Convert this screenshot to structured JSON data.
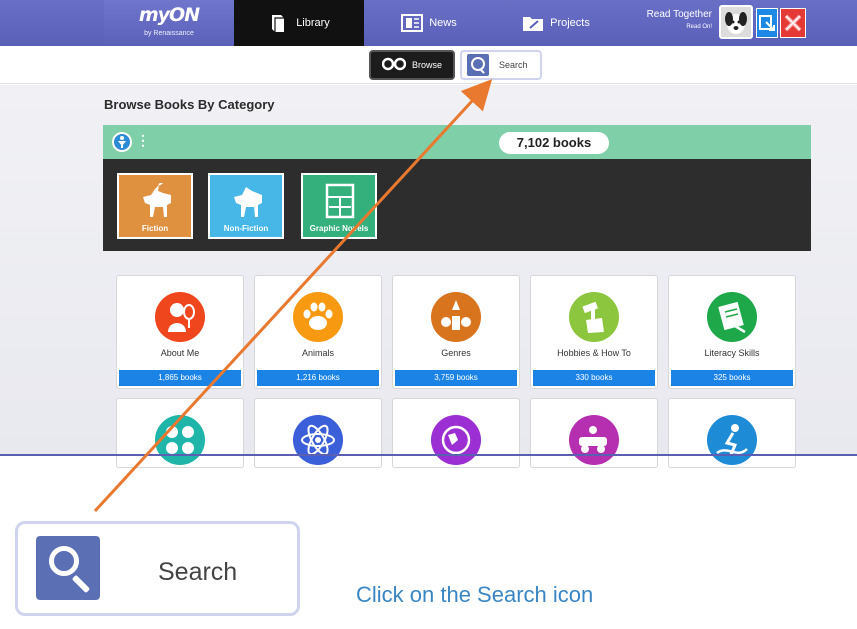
{
  "topnav": {
    "logo": {
      "brand": "myON",
      "subtitle": "by Renaissance"
    },
    "tabs": [
      {
        "label": "Library",
        "icon": "book-icon",
        "active": true
      },
      {
        "label": "News",
        "icon": "news-icon",
        "active": false
      },
      {
        "label": "Projects",
        "icon": "projects-folder-icon",
        "active": false
      }
    ],
    "read_together": {
      "title": "Read Together",
      "subtitle": "Read On!"
    },
    "avatar": "dog-avatar",
    "exit_icon": "exit-icon",
    "close_icon": "close-icon"
  },
  "subnav": {
    "browse_label": "Browse",
    "browse_icon": "binoculars-icon",
    "search_label": "Search",
    "search_icon": "search-book-icon"
  },
  "main": {
    "title": "Browse Books By Category",
    "filter": {
      "count_label": "7,102 books",
      "types": [
        {
          "label": "Fiction",
          "icon": "unicorn-icon",
          "color": "#e0913f"
        },
        {
          "label": "Non-Fiction",
          "icon": "horse-icon",
          "color": "#46b7e6"
        },
        {
          "label": "Graphic Novels",
          "icon": "comic-panels-icon",
          "color": "#33b07b"
        }
      ]
    },
    "categories": [
      {
        "name": "About Me",
        "count": "1,865 books",
        "color": "#f0461e",
        "icon": "person-mirror-icon"
      },
      {
        "name": "Animals",
        "count": "1,216 books",
        "color": "#f79a12",
        "icon": "paw-icon"
      },
      {
        "name": "Genres",
        "count": "3,759 books",
        "color": "#d8731e",
        "icon": "genres-icon"
      },
      {
        "name": "Hobbies & How To",
        "count": "330 books",
        "color": "#8cc63f",
        "icon": "hammer-fist-icon"
      },
      {
        "name": "Literacy Skills",
        "count": "325 books",
        "color": "#1ea84a",
        "icon": "scroll-icon"
      }
    ],
    "row2_icons": [
      {
        "icon": "math-symbols-icon",
        "color": "#1fb5a8"
      },
      {
        "icon": "atom-icon",
        "color": "#3b5fd8"
      },
      {
        "icon": "globe-people-icon",
        "color": "#9b2fd4"
      },
      {
        "icon": "vehicles-icon",
        "color": "#b62fb0"
      },
      {
        "icon": "sports-icon",
        "color": "#1e8bd6"
      }
    ]
  },
  "callout": {
    "search_label": "Search",
    "instruction": "Click on the Search icon",
    "arrow_color": "#e8792f"
  }
}
